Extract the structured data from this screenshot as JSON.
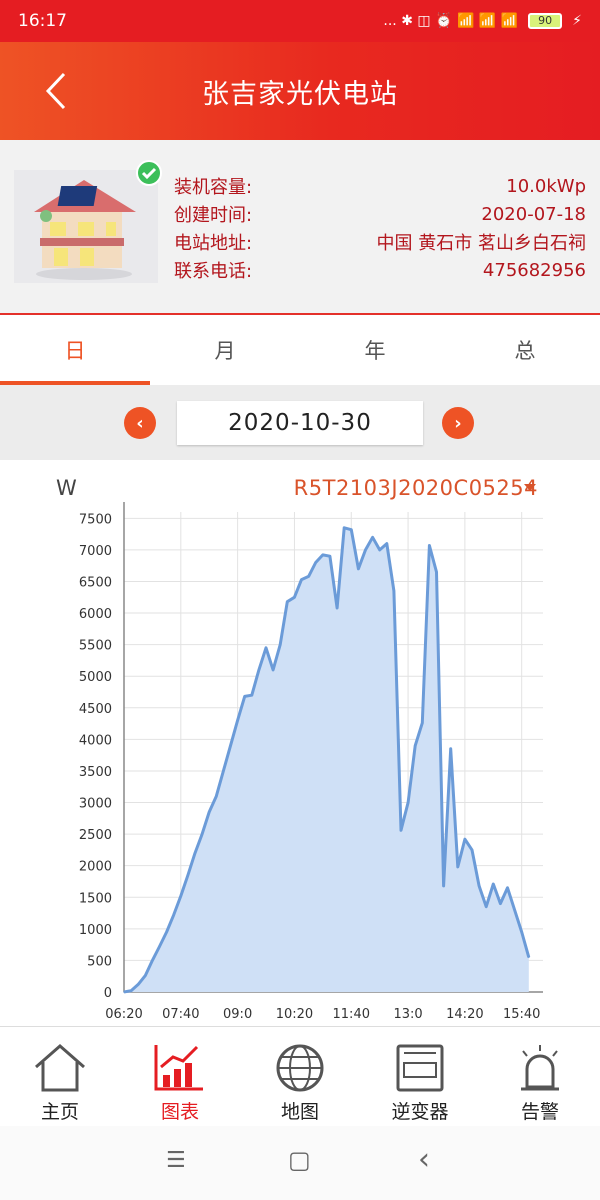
{
  "status": {
    "time": "16:17",
    "icons": "... ✱ ◫ ⏰ 📶 📶 📶",
    "battery": "90"
  },
  "app": {
    "title": "张吉家光伏电站"
  },
  "station": {
    "rows": [
      {
        "label": "装机容量:",
        "value": "10.0kWp"
      },
      {
        "label": "创建时间:",
        "value": "2020-07-18"
      },
      {
        "label": "电站地址:",
        "value": "中国 黄石市 茗山乡白石祠"
      },
      {
        "label": "联系电话:",
        "value": "475682956"
      }
    ]
  },
  "tabs": [
    "日",
    "月",
    "年",
    "总"
  ],
  "date": {
    "value": "2020-10-30",
    "prev": "‹",
    "next": "›"
  },
  "chart_header": {
    "unit": "W",
    "device": "R5T2103J2020C05254"
  },
  "chart_data": {
    "type": "area",
    "x": [
      "06:20",
      "06:30",
      "06:40",
      "06:50",
      "07:00",
      "07:10",
      "07:20",
      "07:30",
      "07:40",
      "07:50",
      "08:00",
      "08:10",
      "08:20",
      "08:30",
      "08:40",
      "08:50",
      "09:00",
      "09:10",
      "09:20",
      "09:30",
      "09:40",
      "09:50",
      "10:00",
      "10:10",
      "10:20",
      "10:30",
      "10:40",
      "10:50",
      "11:00",
      "11:10",
      "11:20",
      "11:30",
      "11:40",
      "11:50",
      "12:00",
      "12:10",
      "12:20",
      "12:30",
      "12:40",
      "12:50",
      "13:00",
      "13:10",
      "13:20",
      "13:30",
      "13:40",
      "13:50",
      "14:00",
      "14:10",
      "14:20",
      "14:30",
      "14:40",
      "14:50",
      "15:00",
      "15:10",
      "15:20",
      "15:30",
      "15:40",
      "15:50",
      "16:00",
      "16:10"
    ],
    "values": [
      0,
      20,
      120,
      260,
      500,
      720,
      950,
      1220,
      1520,
      1850,
      2200,
      2500,
      2850,
      3100,
      3500,
      3900,
      4300,
      4680,
      4700,
      5100,
      5450,
      5100,
      5500,
      6180,
      6250,
      6530,
      6580,
      6800,
      6920,
      6900,
      6080,
      7350,
      7320,
      6700,
      7000,
      7200,
      7000,
      7100,
      6350,
      2560,
      3000,
      3900,
      4260,
      7070,
      6650,
      1680,
      3850,
      1980,
      2420,
      2250,
      1680,
      1350,
      1710,
      1400,
      1650,
      1300,
      950,
      550,
      null,
      null
    ],
    "xticks": [
      "06:20",
      "07:40",
      "09:0",
      "10:20",
      "11:40",
      "13:0",
      "14:20",
      "15:40"
    ],
    "yticks": [
      0,
      500,
      1000,
      1500,
      2000,
      2500,
      3000,
      3500,
      4000,
      4500,
      5000,
      5500,
      6000,
      6500,
      7000,
      7500
    ],
    "ylim": [
      0,
      7600
    ],
    "line_color": "#6b9bd8",
    "fill_color": "#cfe0f6"
  },
  "nav": [
    {
      "label": "主页",
      "icon": "home-icon"
    },
    {
      "label": "图表",
      "icon": "chart-icon"
    },
    {
      "label": "地图",
      "icon": "globe-icon"
    },
    {
      "label": "逆变器",
      "icon": "inverter-icon"
    },
    {
      "label": "告警",
      "icon": "alarm-icon"
    }
  ],
  "system_nav": {
    "menu": "☰",
    "home": "▢",
    "back": "‹"
  }
}
